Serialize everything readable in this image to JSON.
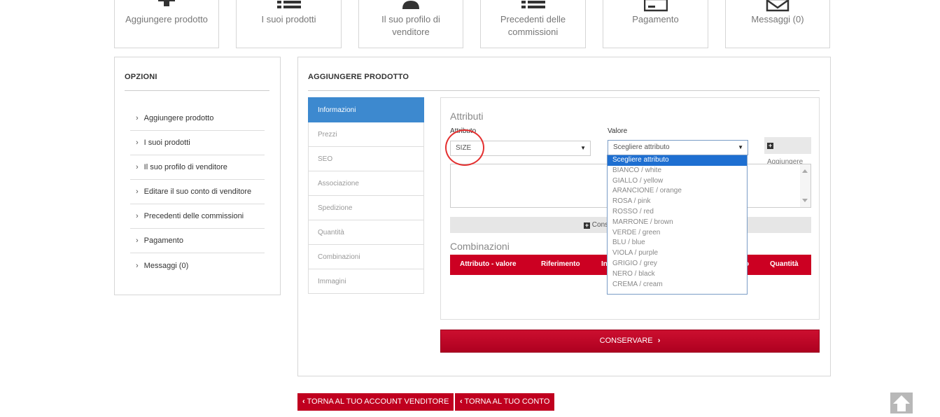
{
  "tiles": [
    {
      "label": "Aggiungere prodotto",
      "icon": "plus-icon"
    },
    {
      "label": "I suoi prodotti",
      "icon": "list-icon"
    },
    {
      "label": "Il suo profilo di venditore",
      "icon": "user-icon"
    },
    {
      "label": "Precedenti delle commissioni",
      "icon": "list-icon"
    },
    {
      "label": "Pagamento",
      "icon": "credit-card-icon"
    },
    {
      "label": "Messaggi (0)",
      "icon": "envelope-icon"
    }
  ],
  "options": {
    "title": "OPZIONI",
    "items": [
      "Aggiungere prodotto",
      "I suoi prodotti",
      "Il suo profilo di venditore",
      "Editare il suo conto di venditore",
      "Precedenti delle commissioni",
      "Pagamento",
      "Messaggi (0)"
    ]
  },
  "main": {
    "title": "AGGIUNGERE PRODOTTO",
    "tabs": [
      "Informazioni",
      "Prezzi",
      "SEO",
      "Associazione",
      "Spedizione",
      "Quantità",
      "Combinazioni",
      "Immagini"
    ],
    "active_tab": "Informazioni"
  },
  "attributes": {
    "section_title": "Attributi",
    "attribute_label": "Attributo",
    "value_label": "Valore",
    "attribute_selected": "SIZE",
    "value_selected": "Scegliere attributo",
    "add_label": "Aggiungere",
    "generate_label": "Cons"
  },
  "combinations": {
    "section_title": "Combinazioni",
    "headers": [
      "Attributo - valore",
      "Riferimento",
      "In",
      "o",
      "Quantità"
    ]
  },
  "dropdown_options": [
    "Scegliere attributo",
    "BIANCO / white",
    "GIALLO / yellow",
    "ARANCIONE / orange",
    "ROSA / pink",
    "ROSSO / red",
    "MARRONE / brown",
    "VERDE / green",
    "BLU / blue",
    "VIOLA / purple",
    "GRIGIO / grey",
    "NERO / black",
    "CREMA / cream"
  ],
  "save_label": "CONSERVARE",
  "back_buttons": [
    "TORNA AL TUO ACCOUNT VENDITORE",
    "TORNA AL TUO CONTO"
  ],
  "colors": {
    "accent_red": "#c0001f",
    "active_tab": "#3d89cf",
    "highlight": "#1e6fd1"
  }
}
